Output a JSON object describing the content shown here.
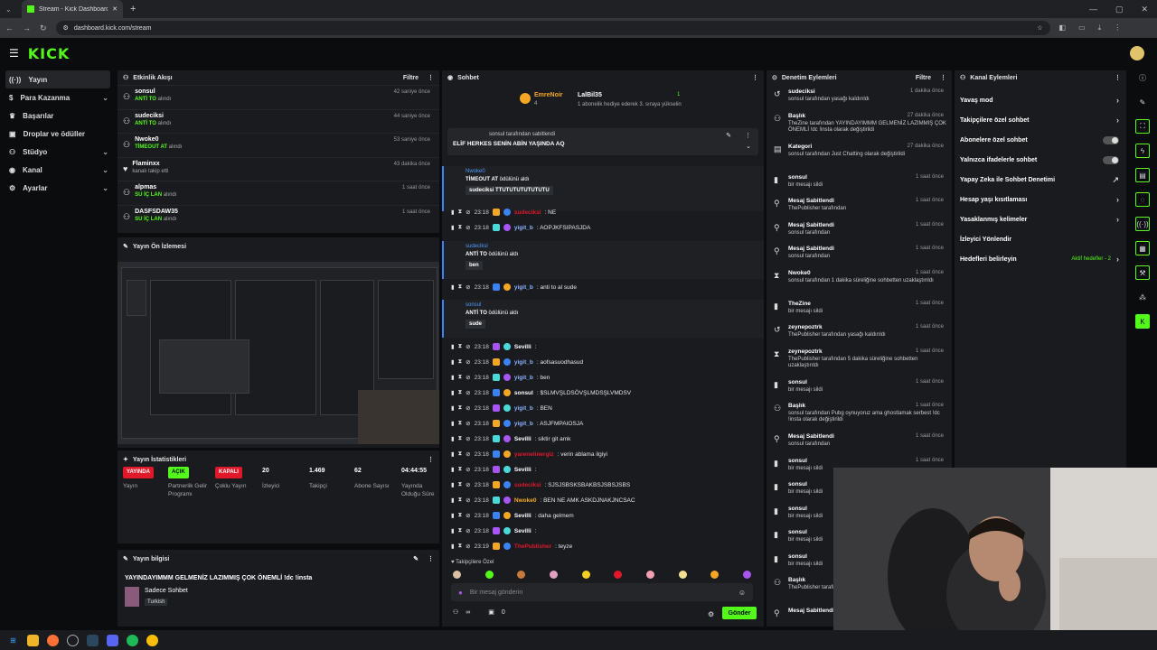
{
  "browser": {
    "tab_title": "Stream - Kick Dashboard",
    "url": "dashboard.kick.com/stream"
  },
  "brand": {
    "logo": "KICK",
    "accent": "#53fc18"
  },
  "sidebar": {
    "items": [
      {
        "label": "Yayın",
        "icon": "broadcast-icon",
        "expand": false
      },
      {
        "label": "Para Kazanma",
        "icon": "money-icon",
        "expand": true
      },
      {
        "label": "Başarılar",
        "icon": "trophy-icon",
        "expand": false
      },
      {
        "label": "Droplar ve ödüller",
        "icon": "gift-icon",
        "expand": false
      },
      {
        "label": "Stüdyo",
        "icon": "studio-icon",
        "expand": true
      },
      {
        "label": "Kanal",
        "icon": "channel-icon",
        "expand": true
      },
      {
        "label": "Ayarlar",
        "icon": "gear-icon",
        "expand": true
      }
    ]
  },
  "activity": {
    "title": "Etkinlik Akışı",
    "filter": "Filtre",
    "items": [
      {
        "name": "sonsul",
        "reward": "ANTİ TO",
        "suffix": " alındı",
        "time": "42 saniye önce"
      },
      {
        "name": "sudeciksi",
        "reward": "ANTİ TO",
        "suffix": " alındı",
        "time": "44 saniye önce"
      },
      {
        "name": "Nwoke0",
        "reward": "TİMEOUT AT",
        "suffix": " alındı",
        "time": "53 saniye önce"
      },
      {
        "name": "Flaminxx",
        "reward": "",
        "suffix": "kanalı takip etti",
        "time": "43 dakika önce"
      },
      {
        "name": "alpmas",
        "reward": "SU İÇ LAN",
        "suffix": " alındı",
        "time": "1 saat önce"
      },
      {
        "name": "DASFSDAW35",
        "reward": "SU İÇ LAN",
        "suffix": " alındı",
        "time": "1 saat önce"
      }
    ]
  },
  "preview": {
    "title": "Yayın Ön İzlemesi"
  },
  "stats": {
    "title": "Yayın İstatistikleri",
    "items": [
      {
        "value": "YAYINDA",
        "label": "Yayın",
        "color": "#e0182a"
      },
      {
        "value": "AÇIK",
        "label": "Partnerlik Gelir Programı",
        "color": "#53fc18"
      },
      {
        "value": "KAPALI",
        "label": "Çoklu Yayın",
        "color": "#e0182a"
      },
      {
        "value": "20",
        "label": "İzleyici"
      },
      {
        "value": "1.469",
        "label": "Takipçi"
      },
      {
        "value": "62",
        "label": "Abone Sayısı"
      },
      {
        "value": "04:44:55",
        "label": "Yayında Olduğu Süre"
      }
    ]
  },
  "info": {
    "title": "Yayın bilgisi",
    "stream_title": "YAYINDAYIMMM GELMENİZ LAZIMMIŞ ÇOK ÖNEMLİ !dc !insta",
    "category": "Sadece Sohbet",
    "language": "Turkish"
  },
  "chat": {
    "title": "Sohbet",
    "leaders": [
      {
        "name": "EmreNoir",
        "count": "4"
      },
      {
        "name": "LalBil35",
        "count": "1"
      }
    ],
    "leader_note": "1 abonelik hediye ederek 3. sıraya yükselin",
    "pinned_by": "sonsul tarafından sabitlendi",
    "pinned_msg": "ELİF HERKES SENİN ABİN YAŞINDA AQ",
    "redeems": [
      {
        "user": "Nwoke0",
        "reward": "TİMEOUT AT",
        "suffix": " ödülünü aldı",
        "msg": "sudeciksi TTUTUTUTUTUTUTU"
      },
      {
        "user": "sudeciksi",
        "reward": "ANTİ TO",
        "suffix": " ödülünü aldı",
        "msg": "ben"
      },
      {
        "user": "sonsul",
        "reward": "ANTİ TO",
        "suffix": " ödülünü aldı",
        "msg": "sude"
      }
    ],
    "messages": [
      {
        "time": "23:18",
        "user": "sudeciksi",
        "color": "#e0182a",
        "text": ": NE"
      },
      {
        "time": "23:18",
        "user": "yigit_b",
        "color": "#8ab4ff",
        "text": ": AOPJKFSIPASJDA"
      },
      {
        "time": "23:18",
        "user": "yigit_b",
        "color": "#8ab4ff",
        "text": ": anti to al sude"
      },
      {
        "time": "23:18",
        "user": "Sevilli",
        "color": "#ffffff",
        "text": ":"
      },
      {
        "time": "23:18",
        "user": "yigit_b",
        "color": "#8ab4ff",
        "text": ": aofsasuodhasud"
      },
      {
        "time": "23:18",
        "user": "yigit_b",
        "color": "#8ab4ff",
        "text": ": ben"
      },
      {
        "time": "23:18",
        "user": "sonsul",
        "color": "#ffffff",
        "text": ": $SLMVŞLDSÖVŞLMDSŞLVMDSV"
      },
      {
        "time": "23:18",
        "user": "yigit_b",
        "color": "#8ab4ff",
        "text": ": BEN"
      },
      {
        "time": "23:18",
        "user": "yigit_b",
        "color": "#8ab4ff",
        "text": ": ASJFMPAIOSJA"
      },
      {
        "time": "23:18",
        "user": "Sevilli",
        "color": "#ffffff",
        "text": ": siktir git amk"
      },
      {
        "time": "23:18",
        "user": "yarenelinergiz",
        "color": "#e0182a",
        "text": ": verin ablama ilgiyi"
      },
      {
        "time": "23:18",
        "user": "Sevilli",
        "color": "#ffffff",
        "text": ":"
      },
      {
        "time": "23:18",
        "user": "sudeciksi",
        "color": "#e0182a",
        "text": ": SJSJSBSKSBAKBSJSBSJSBS"
      },
      {
        "time": "23:18",
        "user": "Nwoke0",
        "color": "#f5a623",
        "text": ": BEN NE AMK ASKDJNAKJNCSAC"
      },
      {
        "time": "23:18",
        "user": "Sevilli",
        "color": "#ffffff",
        "text": ": daha gelmem"
      },
      {
        "time": "23:18",
        "user": "Sevilli",
        "color": "#ffffff",
        "text": ":"
      },
      {
        "time": "23:19",
        "user": "ThePublisher",
        "color": "#e0182a",
        "text": ": teyze"
      }
    ],
    "followers_special": "Takipçilere Özel",
    "input_placeholder": "Bir mesaj gönderin",
    "infinity": "∞",
    "count": "0",
    "send": "Gönder"
  },
  "mod": {
    "title": "Denetim Eylemleri",
    "filter": "Filtre",
    "items": [
      {
        "name": "sudeciksi",
        "line": "sonsul tarafından yasağı kaldırıldı",
        "time": "1 dakika önce",
        "icon": "undo-icon"
      },
      {
        "name": "Başlık",
        "line": "TheZine tarafından YAYINDAYIMMM GELMENİZ LAZIMMIŞ ÇOK ÖNEMLİ !dc !insta olarak değiştirildi",
        "time": "27 dakika önce",
        "icon": "title-icon"
      },
      {
        "name": "Kategori",
        "line": "sonsul tarafından Just Chatting olarak değiştirildi",
        "time": "27 dakika önce",
        "icon": "category-icon"
      },
      {
        "name": "sonsul",
        "line": "bir mesajı sildi",
        "time": "1 saat önce",
        "icon": "trash-icon"
      },
      {
        "name": "Mesaj Sabitlendi",
        "line": "ThePublisher tarafından",
        "time": "1 saat önce",
        "icon": "pin-icon"
      },
      {
        "name": "Mesaj Sabitlendi",
        "line": "sonsul tarafından",
        "time": "1 saat önce",
        "icon": "pin-icon"
      },
      {
        "name": "Mesaj Sabitlendi",
        "line": "sonsul tarafından",
        "time": "1 saat önce",
        "icon": "pin-icon"
      },
      {
        "name": "Nwoke0",
        "line": "sonsul tarafından 1 dakika süreliğine sohbetten uzaklaştırıldı",
        "time": "1 saat önce",
        "icon": "hourglass-icon"
      },
      {
        "name": "TheZine",
        "line": "bir mesajı sildi",
        "time": "1 saat önce",
        "icon": "trash-icon"
      },
      {
        "name": "zeynepoztrk",
        "line": "ThePublisher tarafından yasağı kaldırıldı",
        "time": "1 saat önce",
        "icon": "undo-icon"
      },
      {
        "name": "zeynepoztrk",
        "line": "ThePublisher tarafından 5 dakika süreliğine sohbetten uzaklaştırıldı",
        "time": "1 saat önce",
        "icon": "hourglass-icon"
      },
      {
        "name": "sonsul",
        "line": "bir mesajı sildi",
        "time": "1 saat önce",
        "icon": "trash-icon"
      },
      {
        "name": "Başlık",
        "line": "sonsul tarafından Pubg oynuyoruz ama ghostlamak serbest !dc !insta olarak değiştirildi",
        "time": "1 saat önce",
        "icon": "title-icon"
      },
      {
        "name": "Mesaj Sabitlendi",
        "line": "sonsul tarafından",
        "time": "1 saat önce",
        "icon": "pin-icon"
      },
      {
        "name": "sonsul",
        "line": "bir mesajı sildi",
        "time": "1 saat önce",
        "icon": "trash-icon"
      },
      {
        "name": "sonsul",
        "line": "bir mesajı sildi",
        "time": "",
        "icon": "trash-icon"
      },
      {
        "name": "sonsul",
        "line": "bir mesajı sildi",
        "time": "",
        "icon": "trash-icon"
      },
      {
        "name": "sonsul",
        "line": "bir mesajı sildi",
        "time": "",
        "icon": "trash-icon"
      },
      {
        "name": "sonsul",
        "line": "bir mesajı sildi",
        "time": "",
        "icon": "trash-icon"
      },
      {
        "name": "Başlık",
        "line": "ThePublisher tarafından !dc !insta olarak değiştirildi",
        "time": "",
        "icon": "title-icon"
      },
      {
        "name": "Mesaj Sabitlendi",
        "line": "",
        "time": "",
        "icon": "pin-icon"
      }
    ]
  },
  "channel": {
    "title": "Kanal Eylemleri",
    "items": [
      {
        "label": "Yavaş mod",
        "ctrl": "chevron"
      },
      {
        "label": "Takipçilere özel sohbet",
        "ctrl": "chevron"
      },
      {
        "label": "Abonelere özel sohbet",
        "ctrl": "toggle"
      },
      {
        "label": "Yalnızca ifadelerle sohbet",
        "ctrl": "toggle"
      },
      {
        "label": "Yapay Zeka ile Sohbet Denetimi",
        "ctrl": "external"
      },
      {
        "label": "Hesap yaşı kısıtlaması",
        "ctrl": "chevron"
      },
      {
        "label": "Yasaklanmış kelimeler",
        "ctrl": "chevron"
      },
      {
        "label": "İzleyici Yönlendir",
        "ctrl": ""
      },
      {
        "label": "Hedefleri belirleyin",
        "ctrl": "chevron",
        "note": "Aktif hedefler - 2"
      }
    ]
  }
}
